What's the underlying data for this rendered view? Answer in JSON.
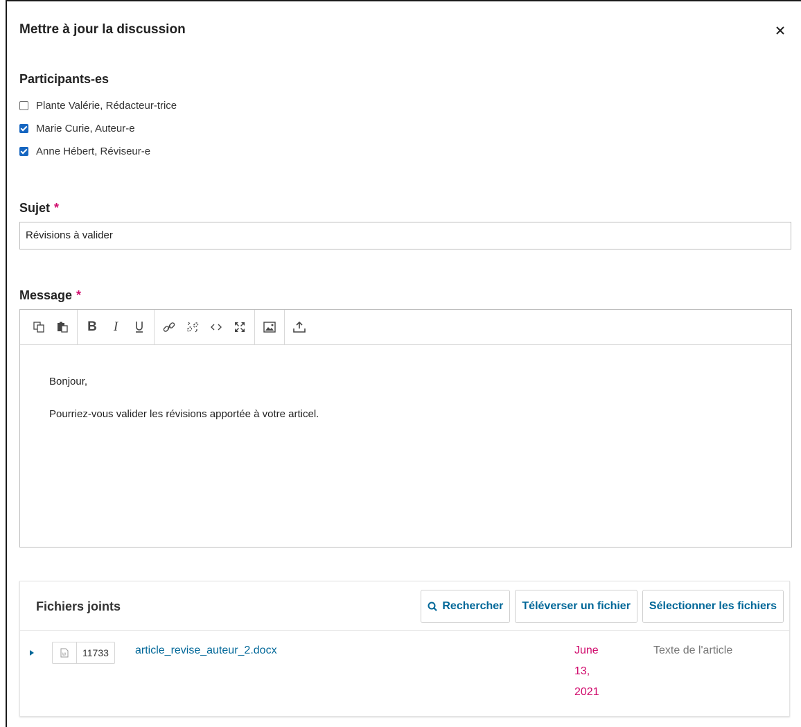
{
  "modal": {
    "title": "Mettre à jour la discussion",
    "close_icon": "close-icon"
  },
  "participants": {
    "label": "Participants-es",
    "items": [
      {
        "label": "Plante Valérie, Rédacteur-trice",
        "checked": false
      },
      {
        "label": "Marie Curie, Auteur-e",
        "checked": true
      },
      {
        "label": "Anne Hébert, Réviseur-e",
        "checked": true
      }
    ]
  },
  "subject": {
    "label": "Sujet",
    "required_mark": "*",
    "value": "Révisions à valider"
  },
  "message": {
    "label": "Message",
    "required_mark": "*",
    "toolbar_icons": [
      "copy-icon",
      "paste-icon",
      "bold-icon",
      "italic-icon",
      "underline-icon",
      "link-icon",
      "unlink-icon",
      "code-icon",
      "fullscreen-icon",
      "image-icon",
      "upload-icon"
    ],
    "body": {
      "greeting": "Bonjour,",
      "line": "Pourriez-vous valider les révisions apportée à votre articel."
    }
  },
  "attachments": {
    "title": "Fichiers joints",
    "search_label": "Rechercher",
    "upload_label": "Téléverser un fichier",
    "select_label": "Sélectionner les fichiers",
    "files": [
      {
        "id": "11733",
        "name": "article_revise_auteur_2.docx",
        "date": "June 13, 2021",
        "type": "Texte de l'article",
        "icon": "word-file-icon"
      }
    ]
  },
  "colors": {
    "accent": "#006798",
    "required": "#d00a6c",
    "checkbox": "#1565c0"
  }
}
